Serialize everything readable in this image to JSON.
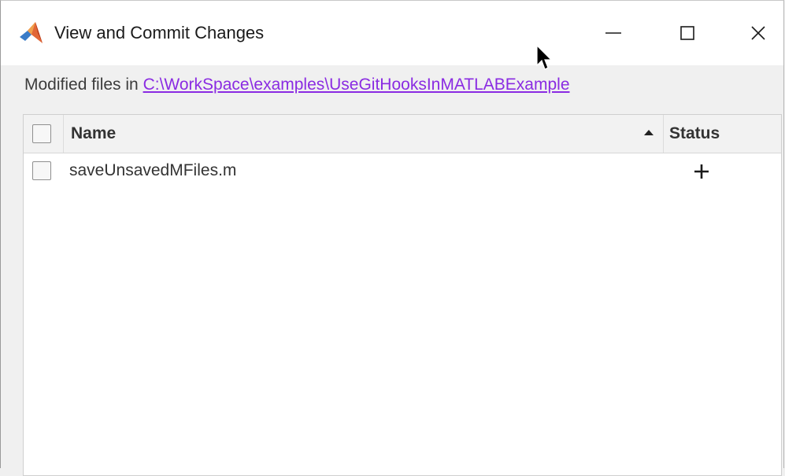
{
  "window": {
    "title": "View and Commit Changes",
    "icon": "matlab-logo-icon",
    "controls": [
      "minimize-icon",
      "maximize-icon",
      "close-icon"
    ]
  },
  "path": {
    "prefix": "Modified files in ",
    "link": "C:\\WorkSpace\\examples\\UseGitHooksInMATLABExample",
    "link_color": "#8a2be2"
  },
  "table": {
    "columns": {
      "name": "Name",
      "status": "Status"
    },
    "sort": {
      "column": "name",
      "direction": "ascending",
      "icon": "sort-ascending-icon"
    },
    "rows": [
      {
        "name": "saveUnsavedMFiles.m",
        "checked": false,
        "status_icon": "added-plus-icon"
      }
    ]
  },
  "colors": {
    "titlebar_bg": "#ffffff",
    "window_bg": "#f0f0f0",
    "table_header_bg": "#f2f2f2"
  }
}
